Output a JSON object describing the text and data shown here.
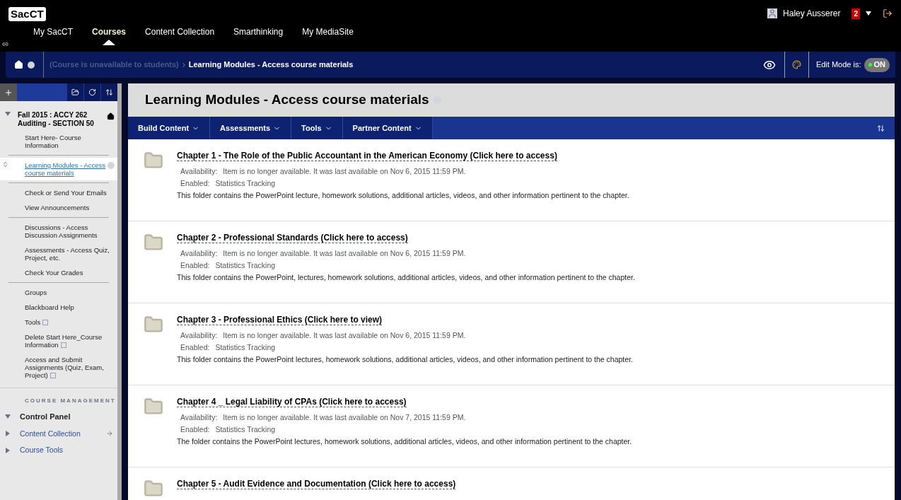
{
  "header": {
    "logo": "SacCT",
    "user": "Haley Ausserer",
    "notification_count": "2"
  },
  "nav_tabs": [
    {
      "label": "My SacCT",
      "selected": false
    },
    {
      "label": "Courses",
      "selected": true
    },
    {
      "label": "Content Collection",
      "selected": false
    },
    {
      "label": "Smarthinking",
      "selected": false
    },
    {
      "label": "My MediaSite",
      "selected": false
    }
  ],
  "breadcrumb": {
    "status": "(Course is unavailable to students)",
    "current": "Learning Modules - Access course materials"
  },
  "edit_mode": {
    "label": "Edit Mode is:",
    "value": "ON",
    "on": true
  },
  "sidebar": {
    "course_title": "Fall 2015 : ACCY 262 Auditing - SECTION 50",
    "sections": [
      [
        {
          "label": "Start Here- Course Information",
          "selected": false,
          "hidden": false
        }
      ],
      [
        {
          "label": "Learning Modules - Access course materials",
          "selected": true,
          "hidden": false
        }
      ],
      [
        {
          "label": "Check or Send Your Emails",
          "selected": false,
          "hidden": false
        },
        {
          "label": "View Announcements",
          "selected": false,
          "hidden": false
        }
      ],
      [
        {
          "label": "Discussions - Access Discussion Assignments",
          "selected": false,
          "hidden": false
        },
        {
          "label": "Assessments - Access Quiz, Project, etc.",
          "selected": false,
          "hidden": false
        },
        {
          "label": "Check Your Grades",
          "selected": false,
          "hidden": false
        }
      ],
      [
        {
          "label": "Groups",
          "selected": false,
          "hidden": false
        },
        {
          "label": "Blackboard Help",
          "selected": false,
          "hidden": false
        },
        {
          "label": "Tools",
          "selected": false,
          "hidden": true
        },
        {
          "label": "Delete Start Here_Course Information",
          "selected": false,
          "hidden": true
        },
        {
          "label": "Access and Submit Assignments (Quiz, Exam, Project)",
          "selected": false,
          "hidden": true
        }
      ]
    ],
    "management_heading": "COURSE MANAGEMENT",
    "control_panel": {
      "label": "Control Panel",
      "expanded": true,
      "children": [
        {
          "label": "Content Collection",
          "expanded": false
        },
        {
          "label": "Course Tools",
          "expanded": false
        }
      ]
    }
  },
  "page_title": "Learning Modules - Access course materials",
  "action_menus": [
    "Build Content",
    "Assessments",
    "Tools",
    "Partner Content"
  ],
  "items": [
    {
      "title": "Chapter 1 - The Role of the Public Accountant in the American Economy (Click here to access)",
      "availability_label": "Availability:",
      "availability": "Item is no longer available. It was last available on Nov 6, 2015 11:59 PM.",
      "enabled_label": "Enabled:",
      "enabled": "Statistics Tracking",
      "description": "This folder contains the PowerPoint lecture, homework solutions, additional articles, videos, and other information pertinent to the chapter."
    },
    {
      "title": "Chapter 2 - Professional Standards (Click here to access)",
      "availability_label": "Availability:",
      "availability": "Item is no longer available. It was last available on Nov 6, 2015 11:59 PM.",
      "enabled_label": "Enabled:",
      "enabled": "Statistics Tracking",
      "description": "This folder contains the PowerPoint, lectures, homework solutions, additional articles, videos, and other information pertinent to the chapter."
    },
    {
      "title": "Chapter 3 - Professional Ethics (Click here to view)",
      "availability_label": "Availability:",
      "availability": "Item is no longer available. It was last available on Nov 6, 2015 11:59 PM.",
      "enabled_label": "Enabled:",
      "enabled": "Statistics Tracking",
      "description": "This folder contains the PowerPoint lectures, homework solutions, additional articles, videos, and other information pertinent to the chapter."
    },
    {
      "title": "Chapter 4 _ Legal Liability of CPAs (Click here to access)",
      "availability_label": "Availability:",
      "availability": "Item is no longer available. It was last available on Nov 7, 2015 11:59 PM.",
      "enabled_label": "Enabled:",
      "enabled": "Statistics Tracking",
      "description": "The folder contains the PowerPoint lectures, homework solutions, additional articles, videos, and other information pertinent to the chapter."
    },
    {
      "title": "Chapter 5 - Audit Evidence and Documentation (Click here to access)"
    }
  ]
}
